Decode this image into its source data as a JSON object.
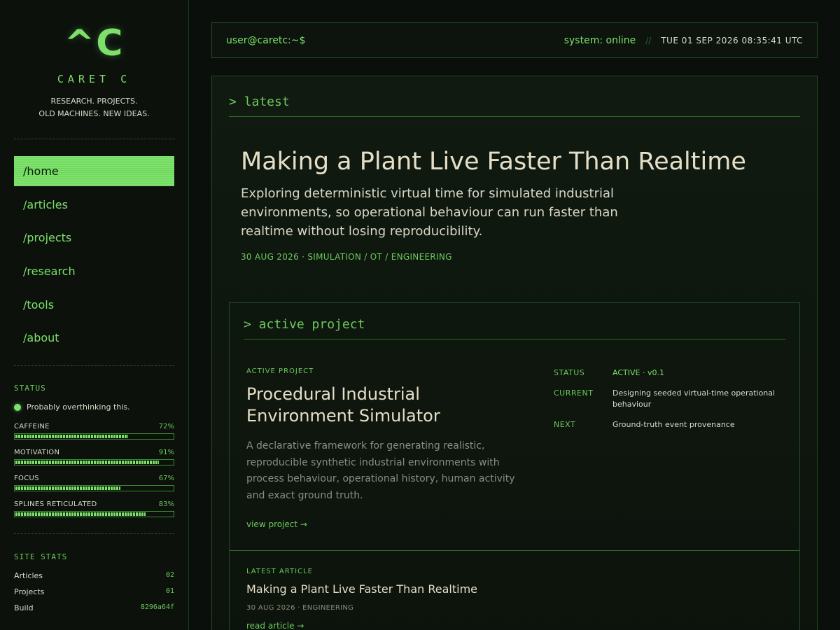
{
  "brand": {
    "logo": "^C",
    "name": "CARET C",
    "tagline_line1": "RESEARCH. PROJECTS.",
    "tagline_line2": "OLD MACHINES. NEW IDEAS."
  },
  "nav": {
    "items": [
      {
        "label": "/home",
        "active": true
      },
      {
        "label": "/articles"
      },
      {
        "label": "/projects"
      },
      {
        "label": "/research"
      },
      {
        "label": "/tools"
      },
      {
        "label": "/about"
      }
    ]
  },
  "status": {
    "title": "STATUS",
    "mood": "Probably overthinking this.",
    "bars": [
      {
        "label": "CAFFEINE",
        "pct_text": "72%",
        "value": 72
      },
      {
        "label": "MOTIVATION",
        "pct_text": "91%",
        "value": 91
      },
      {
        "label": "FOCUS",
        "pct_text": "67%",
        "value": 67
      },
      {
        "label": "SPLINES RETICULATED",
        "pct_text": "83%",
        "value": 83
      }
    ]
  },
  "site_stats": {
    "title": "SITE STATS",
    "rows": [
      {
        "key": "Articles",
        "value": "02"
      },
      {
        "key": "Projects",
        "value": "01"
      },
      {
        "key": "Build",
        "value": "8296a64f"
      }
    ]
  },
  "topbar": {
    "prompt": "user@caretc:~$",
    "system": "system: online",
    "separator": "//",
    "datetime": "TUE 01 SEP 2026 08:35:41 UTC"
  },
  "latest": {
    "heading": "> latest",
    "title": "Making a Plant Live Faster Than Realtime",
    "summary": "Exploring deterministic virtual time for simulated industrial environments, so operational behaviour can run faster than realtime without losing reproducibility.",
    "meta": "30 AUG 2026 · SIMULATION / OT / ENGINEERING"
  },
  "active_project": {
    "heading": "> active project",
    "eyebrow": "ACTIVE PROJECT",
    "title": "Procedural Industrial Environment Simulator",
    "description": "A declarative framework for generating realistic, reproducible synthetic industrial environments with process behaviour, operational history, human activity and exact ground truth.",
    "link": "view project →",
    "status_key": "STATUS",
    "status_value": "ACTIVE · v0.1",
    "current_key": "CURRENT",
    "current_value": "Designing seeded virtual-time operational behaviour",
    "next_key": "NEXT",
    "next_value": "Ground-truth event provenance"
  },
  "latest_article": {
    "eyebrow": "LATEST ARTICLE",
    "title": "Making a Plant Live Faster Than Realtime",
    "meta": "30 AUG 2026 · ENGINEERING",
    "link": "read article →"
  },
  "colors": {
    "accent": "#7ce06a",
    "background": "#0b0f0b",
    "text": "#d8dccb"
  }
}
